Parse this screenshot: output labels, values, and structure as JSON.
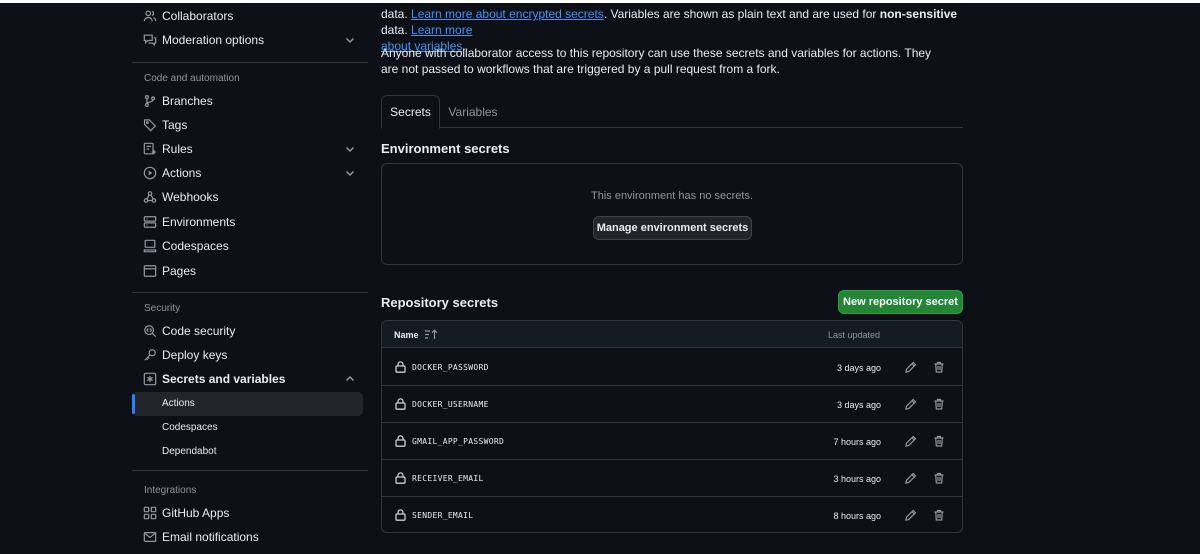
{
  "sidebar": {
    "top_items": [
      {
        "label": "Collaborators"
      },
      {
        "label": "Moderation options"
      }
    ],
    "code_automation": {
      "heading": "Code and automation",
      "items": [
        {
          "label": "Branches"
        },
        {
          "label": "Tags"
        },
        {
          "label": "Rules"
        },
        {
          "label": "Actions"
        },
        {
          "label": "Webhooks"
        },
        {
          "label": "Environments"
        },
        {
          "label": "Codespaces"
        },
        {
          "label": "Pages"
        }
      ]
    },
    "security": {
      "heading": "Security",
      "items": [
        {
          "label": "Code security"
        },
        {
          "label": "Deploy keys"
        },
        {
          "label": "Secrets and variables"
        }
      ],
      "sub_items": [
        {
          "label": "Actions"
        },
        {
          "label": "Codespaces"
        },
        {
          "label": "Dependabot"
        }
      ]
    },
    "integrations": {
      "heading": "Integrations",
      "items": [
        {
          "label": "GitHub Apps"
        },
        {
          "label": "Email notifications"
        }
      ]
    }
  },
  "main": {
    "intro1": {
      "t1": "data. ",
      "link1": "Learn more about encrypted secrets",
      "t2": ". Variables are shown as plain text and are used for ",
      "bold": "non-sensitive",
      "t3": " data. ",
      "link2a": "Learn more",
      "link2b": "about variables",
      "t4": "."
    },
    "intro2": "Anyone with collaborator access to this repository can use these secrets and variables for actions. They are not passed to workflows that are triggered by a pull request from a fork.",
    "tabs": [
      {
        "label": "Secrets"
      },
      {
        "label": "Variables"
      }
    ],
    "environment": {
      "heading": "Environment secrets",
      "empty_text": "This environment has no secrets.",
      "manage_button": "Manage environment secrets"
    },
    "repository": {
      "heading": "Repository secrets",
      "new_button": "New repository secret",
      "col_name": "Name",
      "col_updated": "Last updated",
      "rows": [
        {
          "name": "DOCKER_PASSWORD",
          "updated": "3 days ago"
        },
        {
          "name": "DOCKER_USERNAME",
          "updated": "3 days ago"
        },
        {
          "name": "GMAIL_APP_PASSWORD",
          "updated": "7 hours ago"
        },
        {
          "name": "RECEIVER_EMAIL",
          "updated": "3 hours ago"
        },
        {
          "name": "SENDER_EMAIL",
          "updated": "8 hours ago"
        }
      ]
    }
  },
  "colors": {
    "background": "#0d1117",
    "border": "#30363d",
    "link": "#4493f8",
    "primary_button": "#238636",
    "active_marker": "#2f81f7",
    "muted_text": "#8d96a0"
  },
  "icons": {
    "collaborators": "people-icon",
    "moderation": "comment-discussion-icon",
    "branches": "git-branch-icon",
    "tags": "tag-icon",
    "rules": "rules-icon",
    "actions": "play-icon",
    "webhooks": "webhook-icon",
    "environments": "server-icon",
    "codespaces": "codespaces-icon",
    "pages": "browser-icon",
    "code_security": "codescan-icon",
    "deploy_keys": "key-icon",
    "secrets": "key-asterisk-icon",
    "github_apps": "apps-icon",
    "email": "mail-icon",
    "lock": "lock-icon",
    "edit": "pencil-icon",
    "delete": "trash-icon",
    "sort": "sort-asc-icon",
    "chevron": "chevron-icon"
  }
}
